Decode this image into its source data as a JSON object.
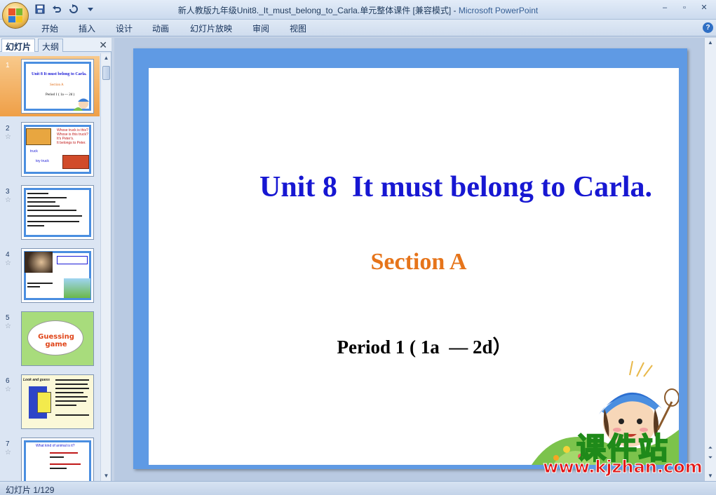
{
  "window": {
    "title": "新人教版九年级Unit8._It_must_belong_to_Carla.单元整体课件 [兼容模式]",
    "separator": " - ",
    "app_name": "Microsoft PowerPoint",
    "controls": {
      "minimize": "–",
      "restore": "▫",
      "close": "✕"
    }
  },
  "quick_access": {
    "save_icon": "save-icon",
    "undo_icon": "undo-icon",
    "redo_icon": "redo-icon",
    "customize_icon": "customize-icon"
  },
  "ribbon": {
    "tabs": [
      {
        "label": "开始"
      },
      {
        "label": "插入"
      },
      {
        "label": "设计"
      },
      {
        "label": "动画"
      },
      {
        "label": "幻灯片放映"
      },
      {
        "label": "审阅"
      },
      {
        "label": "视图"
      }
    ],
    "help": "?"
  },
  "left_pane": {
    "tab_slides": "幻灯片",
    "tab_outline": "大纲",
    "close": "✕",
    "thumbnails": [
      {
        "num": "1",
        "title": "Unit 8  It must belong to Carla.",
        "sub": "Section A",
        "period": "Period 1 ( 1a  — 2d )"
      },
      {
        "num": "2",
        "lines": [
          "Whose truck is this?",
          "Whose is this truck?",
          "It's Peter's.",
          "It belongs to Peter.",
          "truck",
          "toy truck"
        ]
      },
      {
        "num": "3"
      },
      {
        "num": "4"
      },
      {
        "num": "5",
        "bubble": "Guessing game"
      },
      {
        "num": "6",
        "heading": "Look and guess"
      },
      {
        "num": "7",
        "heading": "What kind of animal is it?"
      }
    ]
  },
  "slide": {
    "title": "Unit 8  It must belong to Carla.",
    "section": "Section A",
    "period": "Period 1 ( 1a  — 2d）"
  },
  "watermark": {
    "cn": "课件站",
    "url": "www.kjzhan.com"
  },
  "status": {
    "text": "幻灯片 1/129"
  },
  "colors": {
    "slide_border": "#5f9ae4",
    "title": "#1717d2",
    "section": "#e6741a",
    "selected_thumb": "#ef9f47"
  }
}
